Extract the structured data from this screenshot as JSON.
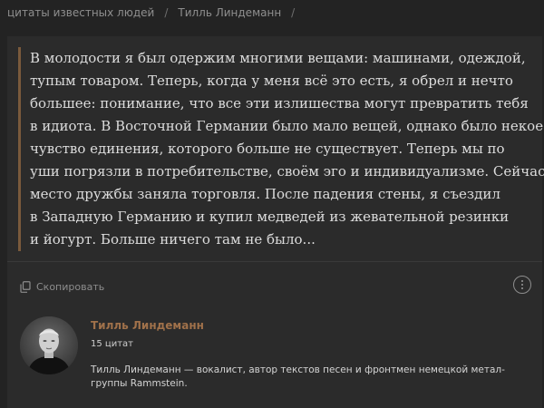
{
  "breadcrumb": {
    "items": [
      "цитаты известных людей",
      "Тилль Линдеманн"
    ],
    "separator": "/"
  },
  "quote": {
    "lines": [
      "В молодости я был одержим многими вещами: машинами, одеждой,",
      "тупым товаром. Теперь, когда у меня всё это есть, я обрел и нечто",
      "большее: понимание, что все эти излишества могут превратить тебя",
      "в идиота. В Восточной Германии было мало вещей, однако было некое",
      "чувство единения, которого больше не существует. Теперь мы по",
      "уши погрязли в потребительстве, своём эго и индивидуализме. Сейчас",
      "место дружбы заняла торговля. После падения стены, я съездил",
      "в Западную Германию и купил медведей из жевательной резинки",
      "и йогурт. Больше ничего там не было..."
    ]
  },
  "actions": {
    "copy_label": "Скопировать",
    "copy_icon": "copy-icon",
    "more_icon": "more-options-icon"
  },
  "author": {
    "name": "Тилль Линдеманн",
    "count": "15 цитат",
    "bio_lines": [
      "Тилль Линдеманн — вокалист, автор текстов песен и фронтмен немецкой метал-",
      "группы Rammstein."
    ]
  },
  "colors": {
    "background": "#232323",
    "card": "#2b2b2b",
    "accent": "#a0714a",
    "quote_border": "#7a5a3c"
  }
}
